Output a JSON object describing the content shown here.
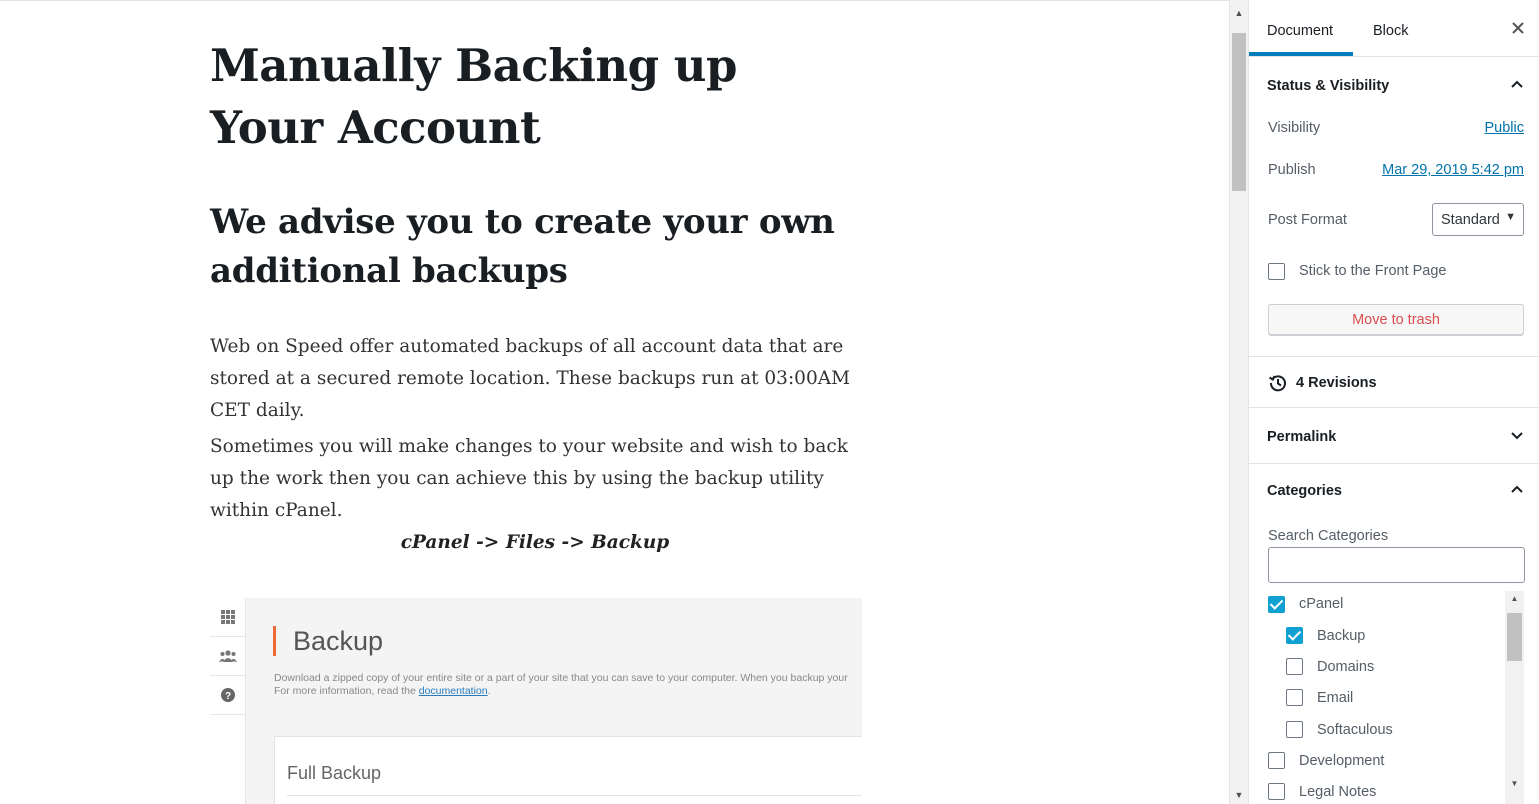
{
  "post": {
    "title": "Manually Backing up Your Account",
    "heading": "We advise you to create your own additional backups",
    "paragraph1": "Web on Speed offer automated backups of all account data that are stored at a secured remote location.  These backups run at 03:00AM CET daily.",
    "paragraph2": "Sometimes you will make changes to your website and wish to back up the work then you can achieve this by using the backup utility within cPanel.",
    "path": "cPanel -> Files -> Backup"
  },
  "embedded_image": {
    "title": "Backup",
    "description_line1": "Download a zipped copy of your entire site or a part of your site that you can save to your computer. When you backup your",
    "description_line2_prefix": "For more information, read the ",
    "description_link": "documentation",
    "description_line2_suffix": ".",
    "card_title": "Full Backup",
    "rail_icons": [
      "grid-icon",
      "users-icon",
      "help-icon"
    ]
  },
  "sidebar": {
    "tabs": [
      {
        "label": "Document",
        "active": true
      },
      {
        "label": "Block",
        "active": false
      }
    ],
    "status_visibility": {
      "title": "Status & Visibility",
      "visibility_label": "Visibility",
      "visibility_value": "Public",
      "publish_label": "Publish",
      "publish_value": "Mar 29, 2019 5:42 pm",
      "post_format_label": "Post Format",
      "post_format_value": "Standard",
      "stick_label": "Stick to the Front Page",
      "stick_checked": false,
      "trash_label": "Move to trash"
    },
    "revisions_label": "4 Revisions",
    "permalink_title": "Permalink",
    "categories": {
      "title": "Categories",
      "search_label": "Search Categories",
      "search_value": "",
      "items": [
        {
          "label": "cPanel",
          "checked": true,
          "level": 0
        },
        {
          "label": "Backup",
          "checked": true,
          "level": 1
        },
        {
          "label": "Domains",
          "checked": false,
          "level": 1
        },
        {
          "label": "Email",
          "checked": false,
          "level": 1
        },
        {
          "label": "Softaculous",
          "checked": false,
          "level": 1
        },
        {
          "label": "Development",
          "checked": false,
          "level": 0
        },
        {
          "label": "Legal Notes",
          "checked": false,
          "level": 0
        }
      ]
    }
  },
  "colors": {
    "accent": "#007cba",
    "link": "#0073aa",
    "checkbox_on": "#11a0d2",
    "trash": "#d94f4f",
    "backup_accent": "#f06a35"
  }
}
